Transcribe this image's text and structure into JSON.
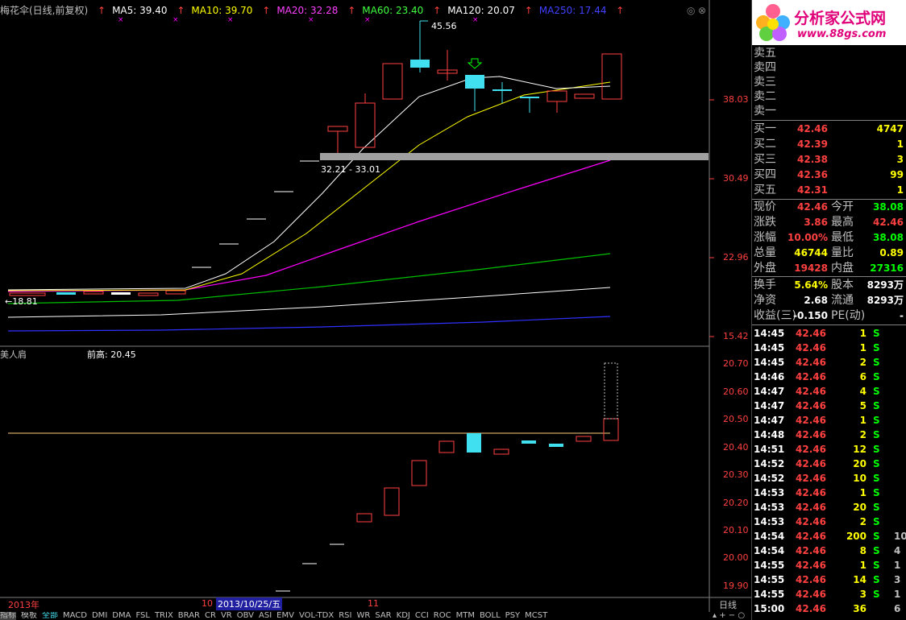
{
  "header": {
    "title": "梅花伞(日线,前复权)",
    "ma5": "MA5: 39.40",
    "ma10": "MA10: 39.70",
    "ma20": "MA20: 32.28",
    "ma60": "MA60: 23.40",
    "ma120": "MA120: 20.07",
    "ma250": "MA250: 17.44",
    "colors": {
      "ma5": "#ffffff",
      "ma10": "#ffff00",
      "ma20": "#ff00ff",
      "ma60": "#00ff00",
      "ma120": "#ffffff",
      "ma250": "#3030ff"
    }
  },
  "main_chart": {
    "y_ticks": [
      "38.03",
      "30.49",
      "22.96",
      "15.42"
    ],
    "high_label": "45.56",
    "low_label": "18.81",
    "range_label": "32.21 - 33.01"
  },
  "sub_chart": {
    "name": "美人肩",
    "prev_high_label": "前高: 20.45",
    "y_ticks": [
      "20.70",
      "20.60",
      "20.50",
      "20.40",
      "20.30",
      "20.20",
      "20.10",
      "20.00",
      "19.90"
    ]
  },
  "date_axis": {
    "year": "2013年",
    "m10": "10",
    "cursor_date": "2013/10/25/五",
    "m11": "11",
    "period": "日线"
  },
  "tabs": [
    "指标",
    "模板",
    "全部",
    "MACD",
    "DMI",
    "DMA",
    "FSL",
    "TRIX",
    "BRAR",
    "CR",
    "VR",
    "OBV",
    "ASI",
    "EMV",
    "VOL-TDX",
    "RSI",
    "WR",
    "SAR",
    "KDJ",
    "CCI",
    "ROC",
    "MTM",
    "BOLL",
    "PSY",
    "MCST"
  ],
  "logo": {
    "brand": "分析家公式网",
    "url": "www.88gs.com"
  },
  "order_book": {
    "sell": [
      {
        "label": "卖五",
        "price": "",
        "vol": ""
      },
      {
        "label": "卖四",
        "price": "",
        "vol": ""
      },
      {
        "label": "卖三",
        "price": "",
        "vol": ""
      },
      {
        "label": "卖二",
        "price": "",
        "vol": ""
      },
      {
        "label": "卖一",
        "price": "",
        "vol": ""
      }
    ],
    "buy": [
      {
        "label": "买一",
        "price": "42.46",
        "vol": "4747"
      },
      {
        "label": "买二",
        "price": "42.39",
        "vol": "1"
      },
      {
        "label": "买三",
        "price": "42.38",
        "vol": "3"
      },
      {
        "label": "买四",
        "price": "42.36",
        "vol": "99"
      },
      {
        "label": "买五",
        "price": "42.31",
        "vol": "1"
      }
    ]
  },
  "quote": [
    {
      "l1": "现价",
      "v1": "42.46",
      "l2": "今开",
      "v2": "38.08"
    },
    {
      "l1": "涨跌",
      "v1": "3.86",
      "l2": "最高",
      "v2": "42.46"
    },
    {
      "l1": "涨幅",
      "v1": "10.00%",
      "l2": "最低",
      "v2": "38.08"
    },
    {
      "l1": "总量",
      "v1": "46744",
      "l2": "量比",
      "v2": "0.89"
    },
    {
      "l1": "外盘",
      "v1": "19428",
      "l2": "内盘",
      "v2": "27316"
    },
    {
      "l1": "换手",
      "v1": "5.64%",
      "l2": "股本",
      "v2": "8293万"
    },
    {
      "l1": "净资",
      "v1": "2.68",
      "l2": "流通",
      "v2": "8293万"
    },
    {
      "l1": "收益(三)",
      "v1": "-0.150",
      "l2": "PE(动)",
      "v2": "-"
    }
  ],
  "ticks": [
    {
      "t": "14:45",
      "p": "42.46",
      "n": "1",
      "s": "S",
      "x": ""
    },
    {
      "t": "14:45",
      "p": "42.46",
      "n": "1",
      "s": "S",
      "x": ""
    },
    {
      "t": "14:45",
      "p": "42.46",
      "n": "2",
      "s": "S",
      "x": ""
    },
    {
      "t": "14:46",
      "p": "42.46",
      "n": "6",
      "s": "S",
      "x": ""
    },
    {
      "t": "14:47",
      "p": "42.46",
      "n": "4",
      "s": "S",
      "x": ""
    },
    {
      "t": "14:47",
      "p": "42.46",
      "n": "5",
      "s": "S",
      "x": ""
    },
    {
      "t": "14:47",
      "p": "42.46",
      "n": "1",
      "s": "S",
      "x": ""
    },
    {
      "t": "14:48",
      "p": "42.46",
      "n": "2",
      "s": "S",
      "x": ""
    },
    {
      "t": "14:51",
      "p": "42.46",
      "n": "12",
      "s": "S",
      "x": ""
    },
    {
      "t": "14:52",
      "p": "42.46",
      "n": "20",
      "s": "S",
      "x": ""
    },
    {
      "t": "14:52",
      "p": "42.46",
      "n": "10",
      "s": "S",
      "x": ""
    },
    {
      "t": "14:53",
      "p": "42.46",
      "n": "1",
      "s": "S",
      "x": ""
    },
    {
      "t": "14:53",
      "p": "42.46",
      "n": "20",
      "s": "S",
      "x": ""
    },
    {
      "t": "14:53",
      "p": "42.46",
      "n": "2",
      "s": "S",
      "x": ""
    },
    {
      "t": "14:54",
      "p": "42.46",
      "n": "200",
      "s": "S",
      "x": "10"
    },
    {
      "t": "14:54",
      "p": "42.46",
      "n": "8",
      "s": "S",
      "x": "4"
    },
    {
      "t": "14:55",
      "p": "42.46",
      "n": "1",
      "s": "S",
      "x": "1"
    },
    {
      "t": "14:55",
      "p": "42.46",
      "n": "14",
      "s": "S",
      "x": "3"
    },
    {
      "t": "14:55",
      "p": "42.46",
      "n": "3",
      "s": "S",
      "x": "1"
    },
    {
      "t": "15:00",
      "p": "42.46",
      "n": "36",
      "s": "",
      "x": "6"
    }
  ]
}
